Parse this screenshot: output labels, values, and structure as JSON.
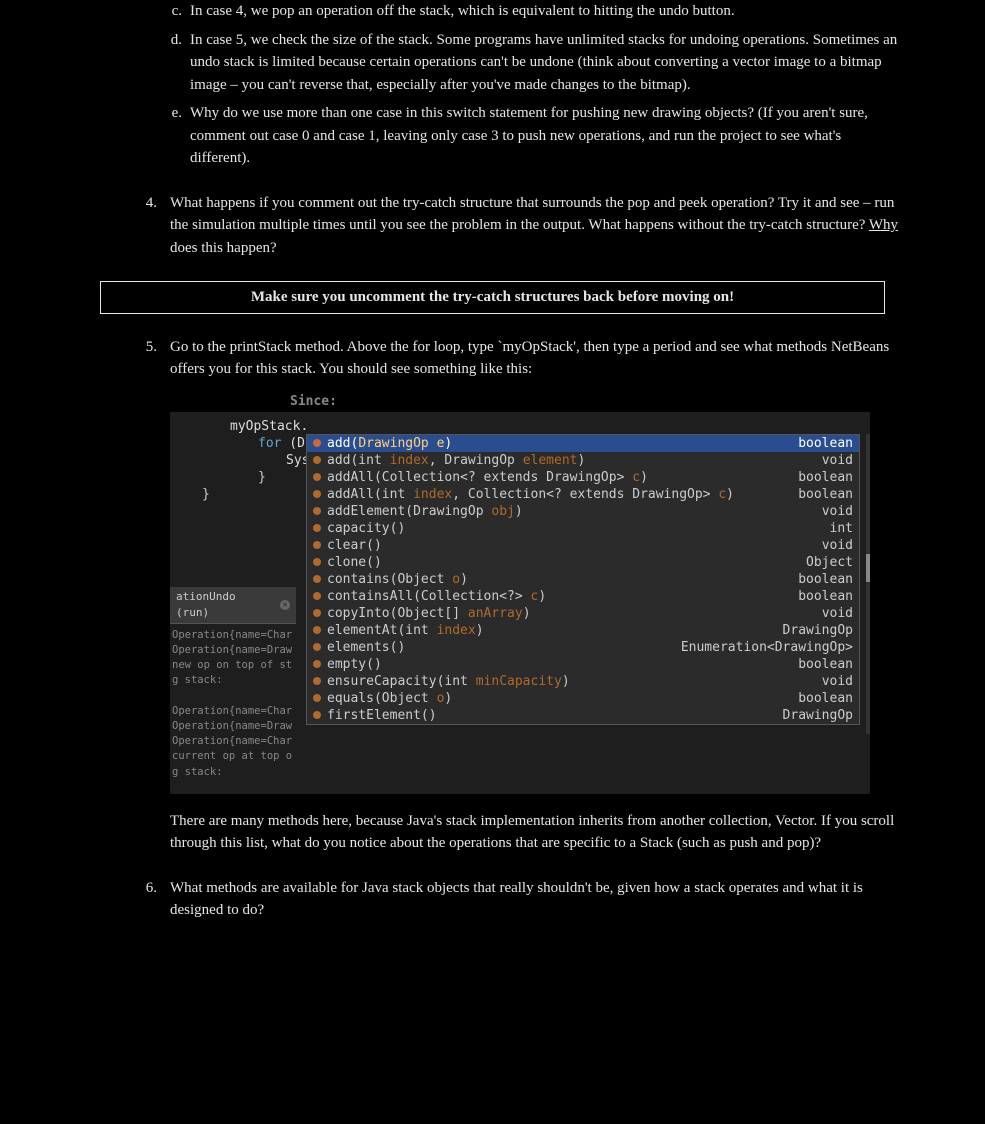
{
  "alpha_items": [
    {
      "marker": "c.",
      "text": "In case 4, we pop an operation off the stack, which is equivalent to hitting the undo button."
    },
    {
      "marker": "d.",
      "text": "In case 5, we check the size of the stack.  Some programs have unlimited stacks for undoing operations.  Sometimes an undo stack is limited because certain operations can't be undone (think about converting a vector image to a bitmap image – you can't reverse that, especially after you've made changes to the bitmap)."
    },
    {
      "marker": "e.",
      "text": "Why do we use more than one case in this switch statement for pushing new drawing objects? (If you aren't sure, comment out case 0 and case 1, leaving only case 3 to push new operations, and run the project to see what's different)."
    }
  ],
  "item4": {
    "marker": "4.",
    "pre": "What happens if you comment out the try-catch structure that surrounds the pop and peek operation?  Try it and see – run the simulation multiple times until you see the problem in the output.  What happens without the try-catch structure?  ",
    "underlined": "Why",
    "post": " does this happen?"
  },
  "callout": "Make sure you uncomment the try-catch structures back before moving on!",
  "item5": {
    "marker": "5.",
    "text": "Go to the printStack method.  Above the for loop, type `myOpStack', then type a period and see what methods NetBeans offers you for this stack.  You should see something like this:",
    "after": "There are many methods here, because Java's stack implementation inherits from another collection, Vector.  If you scroll through this list, what do you notice about the operations that are specific to a Stack (such as push and pop)?"
  },
  "item6": {
    "marker": "6.",
    "text": "What methods are available for Java stack objects that really shouldn't be, given how a stack operates and what it is designed to do?"
  },
  "ide": {
    "top_label": "Since:",
    "code": {
      "l1": "myOpStack.",
      "l2_kw": "for",
      "l2_rest": " (Dra",
      "l3": "Syst",
      "l4": "}",
      "l5": "}"
    },
    "output_tab": "ationUndo (run)",
    "output_lines": [
      "Operation{name=Char",
      "Operation{name=Draw",
      "new op on top of st",
      "g stack:",
      "",
      "Operation{name=Char",
      "Operation{name=Draw",
      "Operation{name=Char",
      "current op at top o",
      "g stack:"
    ],
    "popup": [
      {
        "sel": true,
        "name": "add",
        "sig_pre": "(",
        "arg": "DrawingOp e",
        "sig_post": ")",
        "ret": "boolean"
      },
      {
        "sel": false,
        "name": "add",
        "sig_pre": "(int ",
        "arg": "index",
        "mid": ", DrawingOp ",
        "arg2": "element",
        "sig_post": ")",
        "ret": "void"
      },
      {
        "sel": false,
        "name": "addAll",
        "sig_pre": "(Collection<? extends DrawingOp> ",
        "arg": "c",
        "sig_post": ")",
        "ret": "boolean"
      },
      {
        "sel": false,
        "name": "addAll",
        "sig_pre": "(int ",
        "arg": "index",
        "mid": ", Collection<? extends DrawingOp> ",
        "arg2": "c",
        "sig_post": ")",
        "ret": "boolean"
      },
      {
        "sel": false,
        "name": "addElement",
        "sig_pre": "(DrawingOp ",
        "arg": "obj",
        "sig_post": ")",
        "ret": "void"
      },
      {
        "sel": false,
        "name": "capacity",
        "sig_pre": "()",
        "ret": "int"
      },
      {
        "sel": false,
        "name": "clear",
        "sig_pre": "()",
        "ret": "void"
      },
      {
        "sel": false,
        "name": "clone",
        "sig_pre": "()",
        "ret": "Object"
      },
      {
        "sel": false,
        "name": "contains",
        "sig_pre": "(Object ",
        "arg": "o",
        "sig_post": ")",
        "ret": "boolean"
      },
      {
        "sel": false,
        "name": "containsAll",
        "sig_pre": "(Collection<?> ",
        "arg": "c",
        "sig_post": ")",
        "ret": "boolean"
      },
      {
        "sel": false,
        "name": "copyInto",
        "sig_pre": "(Object[] ",
        "arg": "anArray",
        "sig_post": ")",
        "ret": "void"
      },
      {
        "sel": false,
        "name": "elementAt",
        "sig_pre": "(int ",
        "arg": "index",
        "sig_post": ")",
        "ret": "DrawingOp"
      },
      {
        "sel": false,
        "name": "elements",
        "sig_pre": "()",
        "ret": "Enumeration<DrawingOp>"
      },
      {
        "sel": false,
        "name": "empty",
        "sig_pre": "()",
        "ret": "boolean"
      },
      {
        "sel": false,
        "name": "ensureCapacity",
        "sig_pre": "(int ",
        "arg": "minCapacity",
        "sig_post": ")",
        "ret": "void"
      },
      {
        "sel": false,
        "name": "equals",
        "sig_pre": "(Object ",
        "arg": "o",
        "sig_post": ")",
        "ret": "boolean"
      },
      {
        "sel": false,
        "name": "firstElement",
        "sig_pre": "()",
        "ret": "DrawingOp"
      }
    ]
  }
}
